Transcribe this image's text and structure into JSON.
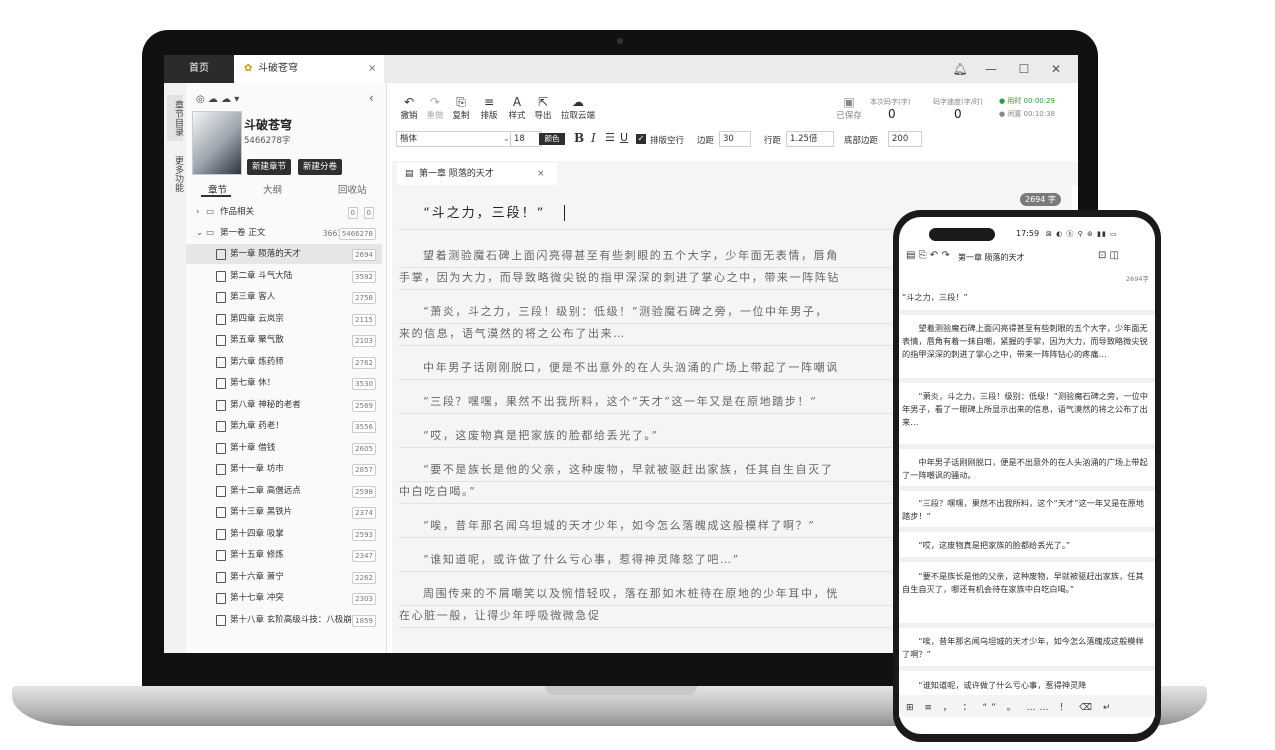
{
  "titlebar": {
    "home_tab": "首页",
    "book_tab": "斗破苍穹",
    "close": "×",
    "min": "—",
    "max": "☐",
    "x": "✕",
    "bell": "bell-icon"
  },
  "rail": {
    "item1": "章节目录",
    "item2": "更多功能"
  },
  "book": {
    "title": "斗破苍穹",
    "words": "5466278字",
    "new_chapter": "新建章节",
    "new_volume": "新建分卷"
  },
  "seg": {
    "chapters": "章节",
    "outline": "大纲",
    "recycle": "回收站"
  },
  "tree": {
    "works": "作品相关",
    "works_count": "0",
    "works_count2": "0",
    "vol1": "第一卷 正文",
    "vol1_count": "3661",
    "vol1_words": "5466278"
  },
  "chapters": [
    {
      "name": "第一章 陨落的天才",
      "count": "2694"
    },
    {
      "name": "第二章 斗气大陆",
      "count": "3592"
    },
    {
      "name": "第三章 客人",
      "count": "2758"
    },
    {
      "name": "第四章 云岚宗",
      "count": "2115"
    },
    {
      "name": "第五章 聚气散",
      "count": "2103"
    },
    {
      "name": "第六章 炼药师",
      "count": "2762"
    },
    {
      "name": "第七章 休！",
      "count": "3530"
    },
    {
      "name": "第八章 神秘的老者",
      "count": "2569"
    },
    {
      "name": "第九章 药老！",
      "count": "3556"
    },
    {
      "name": "第十章 借钱",
      "count": "2605"
    },
    {
      "name": "第十一章 坊市",
      "count": "2857"
    },
    {
      "name": "第十二章 高僧远点",
      "count": "2598"
    },
    {
      "name": "第十三章 黑铁片",
      "count": "2374"
    },
    {
      "name": "第十四章 吸掌",
      "count": "2593"
    },
    {
      "name": "第十五章 修炼",
      "count": "2347"
    },
    {
      "name": "第十六章 萧宁",
      "count": "2262"
    },
    {
      "name": "第十七章 冲突",
      "count": "2303"
    },
    {
      "name": "第十八章 玄阶高级斗技：八极崩",
      "count": "1859"
    }
  ],
  "toolbar": {
    "undo": "撤销",
    "redo": "重做",
    "copy": "复制",
    "layout": "排版",
    "style": "样式",
    "export": "导出",
    "pull": "拉取云端",
    "saved": "已保存",
    "stat1_label": "本次码字(字)",
    "stat1_value": "0",
    "stat2_label": "码字速度(字/时)",
    "stat2_value": "0",
    "time_used": "● 用时 00:00:29",
    "time_idle": "● 闲置 00:10:38"
  },
  "format": {
    "font": "楷体",
    "size": "18",
    "color_btn": "颜色",
    "bold": "B",
    "italic": "I",
    "indent_label": "排版空行",
    "margin_label": "边距",
    "margin_value": "30",
    "spacing_label": "行距",
    "spacing_value": "1.25倍",
    "bottom_label": "底部边距",
    "bottom_value": "200"
  },
  "editor": {
    "tab": "第一章 陨落的天才",
    "tab_close": "×",
    "word_badge": "2694 字",
    "lines": [
      "“斗之力，三段！”",
      "望着测验魔石碑上面闪亮得甚至有些刺眼的五个大字，少年面无表情，唇角",
      "手掌，因为大力，而导致略微尖锐的指甲深深的刺进了掌心之中，带来一阵阵钻",
      "“萧炎，斗之力，三段！级别：低级！”测验魔石碑之旁，一位中年男子，",
      "来的信息，语气漠然的将之公布了出来…",
      "中年男子话刚刚脱口，便是不出意外的在人头汹涌的广场上带起了一阵嘲讽",
      "“三段？嘿嘿，果然不出我所料，这个“天才”这一年又是在原地踏步！”",
      "“哎，这废物真是把家族的脸都给丢光了。”",
      "“要不是族长是他的父亲，这种废物，早就被驱赶出家族，任其自生自灭了",
      "中白吃白喝。”",
      "“唉，昔年那名闻乌坦城的天才少年，如今怎么落魄成这般模样了啊？”",
      "“谁知道呢，或许做了什么亏心事，惹得神灵降怒了吧…”",
      "周围传来的不屑嘲笑以及惋惜轻叹，落在那如木桩待在原地的少年耳中，恍",
      "在心脏一般，让得少年呼吸微微急促"
    ]
  },
  "phone": {
    "time": "17:59",
    "status": "⊠ ◐ ⓑ ⚲ ⊛ ▮▮ ▭",
    "title": "第一章 陨落的天才",
    "badge": "2694字",
    "p1": "“斗之力，三段！”",
    "p2": "　　望着测验魔石碑上面闪亮得甚至有些刺眼的五个大字，少年面无表情，唇角有着一抹自嘲，紧握的手掌，因为大力，而导致略微尖锐的指甲深深的刺进了掌心之中，带来一阵阵钻心的疼痛…",
    "p3": "　　“萧炎，斗之力，三段！级别：低级！”测验魔石碑之旁，一位中年男子，看了一眼碑上所显示出来的信息，语气漠然的将之公布了出来…",
    "p4": "　　中年男子话刚刚脱口，便是不出意外的在人头汹涌的广场上带起了一阵嘲讽的骚动。",
    "p5": "　　“三段？嘿嘿，果然不出我所料，这个“天才”这一年又是在原地踏步！”",
    "p6": "　　“哎，这废物真是把家族的脸都给丢光了。”",
    "p7": "　　“要不是族长是他的父亲，这种废物，早就被驱赶出家族，任其自生自灭了，哪还有机会待在家族中白吃白喝。”",
    "p8": "　　“唉，昔年那名闻乌坦城的天才少年，如今怎么落魄成这般模样了啊？”",
    "p9": "　　“谁知道呢，或许做了什么亏心事，惹得神灵降",
    "keys": "⊞ ≡ ， ： “” 。 …… ！ ⌫ ↵"
  }
}
